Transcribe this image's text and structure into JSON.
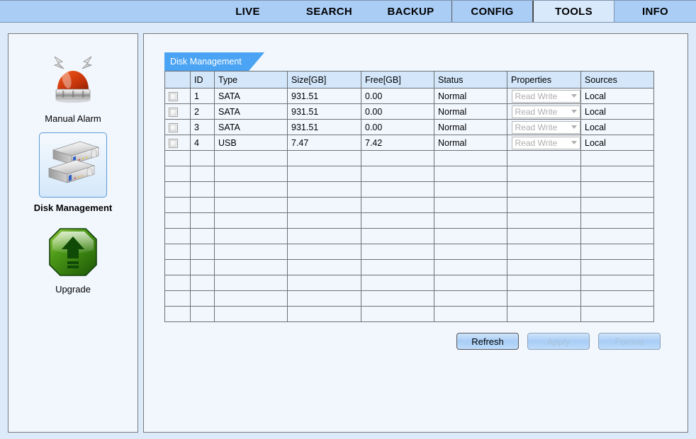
{
  "nav": {
    "tabs": [
      {
        "label": "LIVE",
        "state": "plain",
        "name": "nav-tab-live"
      },
      {
        "label": "SEARCH",
        "state": "plain",
        "name": "nav-tab-search"
      },
      {
        "label": "BACKUP",
        "state": "plain",
        "name": "nav-tab-backup"
      },
      {
        "label": "CONFIG",
        "state": "boxed",
        "name": "nav-tab-config"
      },
      {
        "label": "TOOLS",
        "state": "active",
        "name": "nav-tab-tools"
      },
      {
        "label": "INFO",
        "state": "plain",
        "name": "nav-tab-info"
      }
    ],
    "active": "TOOLS"
  },
  "sidebar": {
    "items": [
      {
        "label": "Manual Alarm",
        "icon": "alarm-siren-icon",
        "selected": false
      },
      {
        "label": "Disk Management",
        "icon": "hard-disk-icon",
        "selected": true
      },
      {
        "label": "Upgrade",
        "icon": "upgrade-arrow-icon",
        "selected": false
      }
    ]
  },
  "main": {
    "section_tab": "Disk Management",
    "table": {
      "columns": [
        "",
        "ID",
        "Type",
        "Size[GB]",
        "Free[GB]",
        "Status",
        "Properties",
        "Sources"
      ],
      "rows": [
        {
          "checked": false,
          "id": "1",
          "type": "SATA",
          "size": "931.51",
          "free": "0.00",
          "status": "Normal",
          "properties": "Read Write",
          "sources": "Local"
        },
        {
          "checked": false,
          "id": "2",
          "type": "SATA",
          "size": "931.51",
          "free": "0.00",
          "status": "Normal",
          "properties": "Read Write",
          "sources": "Local"
        },
        {
          "checked": false,
          "id": "3",
          "type": "SATA",
          "size": "931.51",
          "free": "0.00",
          "status": "Normal",
          "properties": "Read Write",
          "sources": "Local"
        },
        {
          "checked": false,
          "id": "4",
          "type": "USB",
          "size": "7.47",
          "free": "7.42",
          "status": "Normal",
          "properties": "Read Write",
          "sources": "Local"
        }
      ],
      "empty_row_count": 11
    },
    "buttons": [
      {
        "label": "Refresh",
        "enabled": true,
        "name": "refresh-button"
      },
      {
        "label": "Apply",
        "enabled": false,
        "name": "apply-button"
      },
      {
        "label": "Format",
        "enabled": false,
        "name": "format-button"
      }
    ]
  },
  "colors": {
    "nav_bar": "#aacdf6",
    "nav_active": "#d8e9fb",
    "page_bg": "#dceaf9",
    "panel_bg": "#f2f7fe",
    "section_tab": "#4aa3f3",
    "table_header": "#d3e6fa",
    "border": "#6f7275",
    "disabled_text": "#a9c4de"
  }
}
